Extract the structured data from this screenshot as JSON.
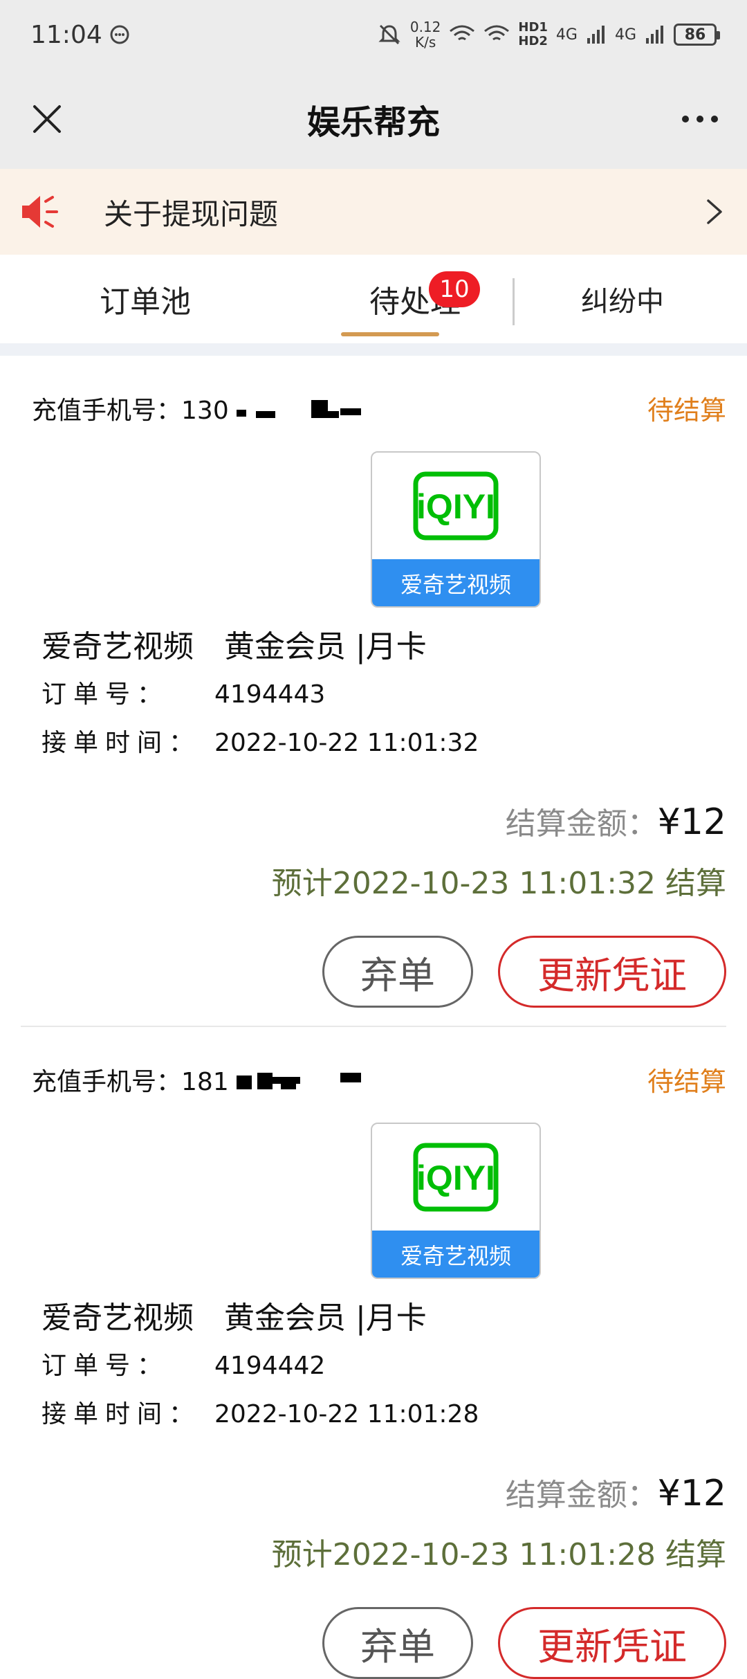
{
  "status_bar": {
    "time": "11:04",
    "net_speed_value": "0.12",
    "net_speed_unit": "K/s",
    "hd1": "HD1",
    "hd2": "HD2",
    "sig1": "4G",
    "sig2": "4G",
    "battery": "86"
  },
  "header": {
    "title": "娱乐帮充"
  },
  "notice": {
    "text": "关于提现问题"
  },
  "tabs": {
    "items": [
      {
        "label": "订单池"
      },
      {
        "label": "待处理",
        "badge": "10"
      },
      {
        "label": "纠纷中"
      }
    ],
    "active_index": 1
  },
  "orders": [
    {
      "phone_label": "充值手机号：",
      "phone_prefix": "130",
      "status": "待结算",
      "logo_wordmark": "iQIYI",
      "logo_caption": "爱奇艺视频",
      "product_name": "爱奇艺视频",
      "product_tier": "黄金会员 |月卡",
      "order_no_label": "订单号：",
      "order_no": "4194443",
      "time_label": "接单时间：",
      "time": "2022-10-22 11:01:32",
      "amount_label": "结算金额：",
      "amount": "¥12",
      "settle_text": "预计2022-10-23 11:01:32 结算",
      "abandon_label": "弃单",
      "update_label": "更新凭证"
    },
    {
      "phone_label": "充值手机号：",
      "phone_prefix": "181",
      "status": "待结算",
      "logo_wordmark": "iQIYI",
      "logo_caption": "爱奇艺视频",
      "product_name": "爱奇艺视频",
      "product_tier": "黄金会员 |月卡",
      "order_no_label": "订单号：",
      "order_no": "4194442",
      "time_label": "接单时间：",
      "time": "2022-10-22 11:01:28",
      "amount_label": "结算金额：",
      "amount": "¥12",
      "settle_text": "预计2022-10-23 11:01:28 结算",
      "abandon_label": "弃单",
      "update_label": "更新凭证"
    }
  ],
  "colors": {
    "accent_orange": "#e07f1c",
    "tab_underline": "#d39a52",
    "badge_red": "#ee1d25",
    "button_red": "#d42a2a",
    "settle_green": "#5d6f3a",
    "iqiyi_green": "#00be06",
    "iqiyi_blue": "#2f8ff0"
  },
  "icons": {
    "close": "close-icon",
    "more": "more-icon",
    "speaker": "speaker-icon",
    "chevron": "chevron-right-icon"
  }
}
